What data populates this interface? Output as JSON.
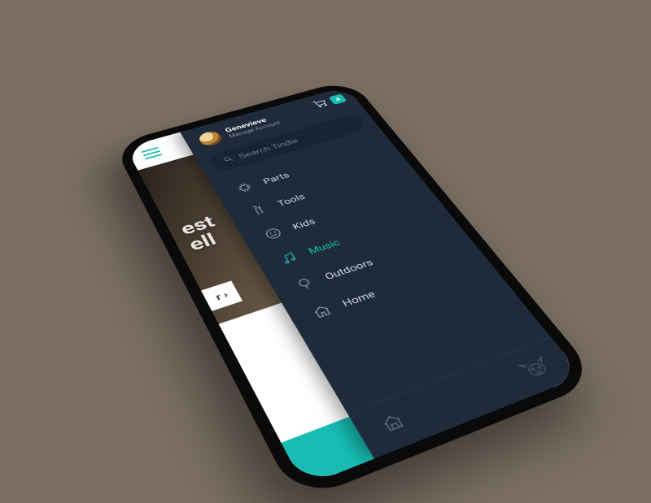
{
  "cart": {
    "count": "4"
  },
  "user": {
    "name": "Genevieve",
    "subtitle": "Manage Account"
  },
  "search": {
    "placeholder": "Search Tindie"
  },
  "nav": {
    "items": [
      {
        "label": "Parts",
        "icon": "chip-icon"
      },
      {
        "label": "Tools",
        "icon": "tools-icon"
      },
      {
        "label": "Kids",
        "icon": "smile-icon"
      },
      {
        "label": "Music",
        "icon": "music-icon"
      },
      {
        "label": "Outdoors",
        "icon": "tree-icon"
      },
      {
        "label": "Home",
        "icon": "house-icon"
      }
    ],
    "active_index": 3
  },
  "hero": {
    "line1": "est",
    "line2": "ell",
    "cta_suffix": "r ›"
  },
  "colors": {
    "accent": "#17bdb3",
    "drawer_bg": "#1f2a3a",
    "search_bg": "#182333"
  }
}
